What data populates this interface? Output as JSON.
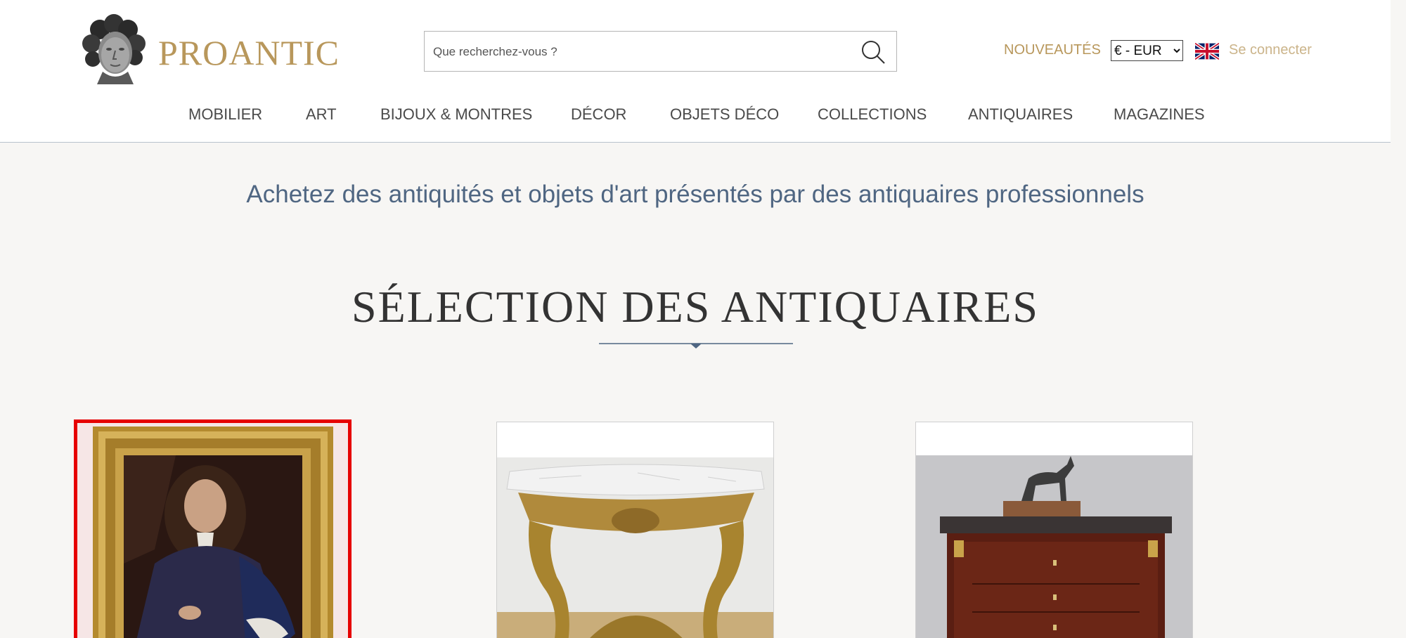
{
  "header": {
    "logo_text": "PROANTIC",
    "search": {
      "placeholder": "Que recherchez-vous ?",
      "value": ""
    },
    "nouveautes_label": "NOUVEAUTÉS",
    "currency": {
      "selected": "€ - EUR"
    },
    "login_label": "Se connecter"
  },
  "nav": {
    "items": [
      {
        "label": "MOBILIER"
      },
      {
        "label": "ART"
      },
      {
        "label": "BIJOUX & MONTRES"
      },
      {
        "label": "DÉCOR"
      },
      {
        "label": "OBJETS DÉCO"
      },
      {
        "label": "COLLECTIONS"
      },
      {
        "label": "ANTIQUAIRES"
      },
      {
        "label": "MAGAZINES"
      }
    ]
  },
  "main": {
    "tagline": "Achetez des antiquités et objets d'art présentés par des antiquaires professionnels",
    "section_title": "SÉLECTION DES ANTIQUAIRES"
  },
  "colors": {
    "brand_gold": "#b8975b",
    "tagline_blue": "#4f6682",
    "selection_red": "#e60000"
  }
}
